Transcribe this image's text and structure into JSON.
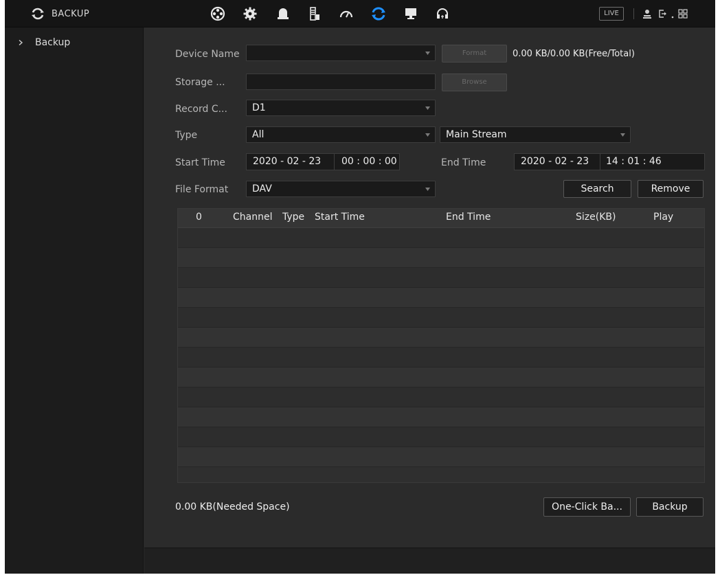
{
  "header": {
    "title": "BACKUP",
    "live_label": "LIVE",
    "nav_icons": [
      "film-reel-icon",
      "gear-icon",
      "alarm-bell-icon",
      "storage-icon",
      "speedometer-icon",
      "backup-sync-icon",
      "monitor-icon",
      "headset-icon"
    ],
    "right_icons": [
      "user-icon",
      "logout-icon",
      "grid-icon"
    ]
  },
  "sidebar": {
    "items": [
      {
        "label": "Backup"
      }
    ]
  },
  "form": {
    "device_name_label": "Device Name",
    "device_name_value": "",
    "format_button": "Format",
    "capacity": "0.00 KB/0.00 KB(Free/Total)",
    "storage_label": "Storage ...",
    "storage_value": "",
    "browse_button": "Browse",
    "record_channel_label": "Record C...",
    "record_channel_value": "D1",
    "type_label": "Type",
    "type_value": "All",
    "stream_value": "Main Stream",
    "start_time_label": "Start Time",
    "start_date": "2020 - 02 - 23",
    "start_clock": "00 : 00 : 00",
    "end_time_label": "End Time",
    "end_date": "2020 - 02 - 23",
    "end_clock": "14 : 01 : 46",
    "file_format_label": "File Format",
    "file_format_value": "DAV",
    "search_button": "Search",
    "remove_button": "Remove"
  },
  "table": {
    "columns": {
      "count": "0",
      "channel": "Channel",
      "type": "Type",
      "start_time": "Start Time",
      "end_time": "End Time",
      "size": "Size(KB)",
      "play": "Play"
    },
    "rows": []
  },
  "footer": {
    "needed_space": "0.00 KB(Needed Space)",
    "one_click_button": "One-Click Ba...",
    "backup_button": "Backup"
  },
  "colors": {
    "active_nav": "#1e90ff",
    "background": "#2b2b2b",
    "topbar": "#151515"
  }
}
